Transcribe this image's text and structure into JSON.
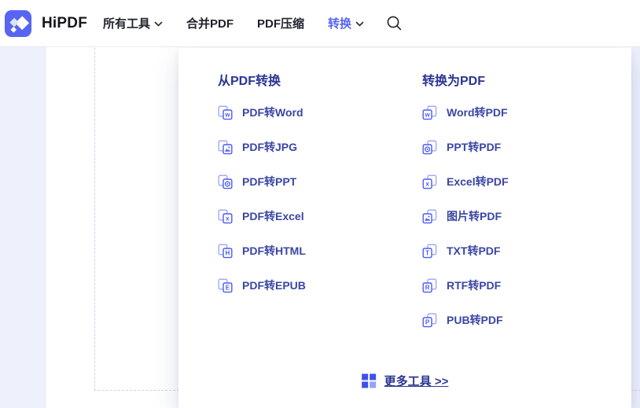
{
  "colors": {
    "accent": "#5865F2",
    "nav-text": "#1F222B",
    "heading-navy": "#2B3593",
    "item-navy": "#3A46A3",
    "icon-front": "#4E5BEF",
    "icon-back": "#9AA4F5",
    "grid-dark": "#4050EE",
    "grid-light": "#93A1F7",
    "gutter": "#EEF1FC",
    "navbar-border": "#E9E9F0",
    "dashed": "#CDD4EC"
  },
  "navbar": {
    "brand": "HiPDF",
    "items": [
      {
        "id": "all-tools",
        "label": "所有工具",
        "has_chevron": true,
        "active": false
      },
      {
        "id": "merge-pdf",
        "label": "合并PDF",
        "has_chevron": false,
        "active": false
      },
      {
        "id": "compress-pdf",
        "label": "PDF压缩",
        "has_chevron": false,
        "active": false
      },
      {
        "id": "convert",
        "label": "转换",
        "has_chevron": true,
        "active": true
      }
    ]
  },
  "dropdown": {
    "columns": [
      {
        "title": "从PDF转换",
        "items": [
          {
            "id": "pdf-to-word",
            "label": "PDF转Word",
            "icon": "pdf-to-word-icon",
            "glyph": "letter",
            "letter": "w"
          },
          {
            "id": "pdf-to-jpg",
            "label": "PDF转JPG",
            "icon": "pdf-to-jpg-icon",
            "glyph": "image"
          },
          {
            "id": "pdf-to-ppt",
            "label": "PDF转PPT",
            "icon": "pdf-to-ppt-icon",
            "glyph": "disc"
          },
          {
            "id": "pdf-to-excel",
            "label": "PDF转Excel",
            "icon": "pdf-to-excel-icon",
            "glyph": "letter",
            "letter": "x"
          },
          {
            "id": "pdf-to-html",
            "label": "PDF转HTML",
            "icon": "pdf-to-html-icon",
            "glyph": "letter",
            "letter": "H"
          },
          {
            "id": "pdf-to-epub",
            "label": "PDF转EPUB",
            "icon": "pdf-to-epub-icon",
            "glyph": "letter",
            "letter": "E"
          }
        ]
      },
      {
        "title": "转换为PDF",
        "items": [
          {
            "id": "word-to-pdf",
            "label": "Word转PDF",
            "icon": "word-to-pdf-icon",
            "glyph": "letter",
            "letter": "w"
          },
          {
            "id": "ppt-to-pdf",
            "label": "PPT转PDF",
            "icon": "ppt-to-pdf-icon",
            "glyph": "disc"
          },
          {
            "id": "excel-to-pdf",
            "label": "Excel转PDF",
            "icon": "excel-to-pdf-icon",
            "glyph": "letter",
            "letter": "x"
          },
          {
            "id": "image-to-pdf",
            "label": "图片转PDF",
            "icon": "image-to-pdf-icon",
            "glyph": "image"
          },
          {
            "id": "txt-to-pdf",
            "label": "TXT转PDF",
            "icon": "txt-to-pdf-icon",
            "glyph": "letter",
            "letter": "T"
          },
          {
            "id": "rtf-to-pdf",
            "label": "RTF转PDF",
            "icon": "rtf-to-pdf-icon",
            "glyph": "letter",
            "letter": "R"
          },
          {
            "id": "pub-to-pdf",
            "label": "PUB转PDF",
            "icon": "pub-to-pdf-icon",
            "glyph": "letter",
            "letter": "P"
          }
        ]
      }
    ],
    "more_link": {
      "label": "更多工具 >>"
    }
  }
}
